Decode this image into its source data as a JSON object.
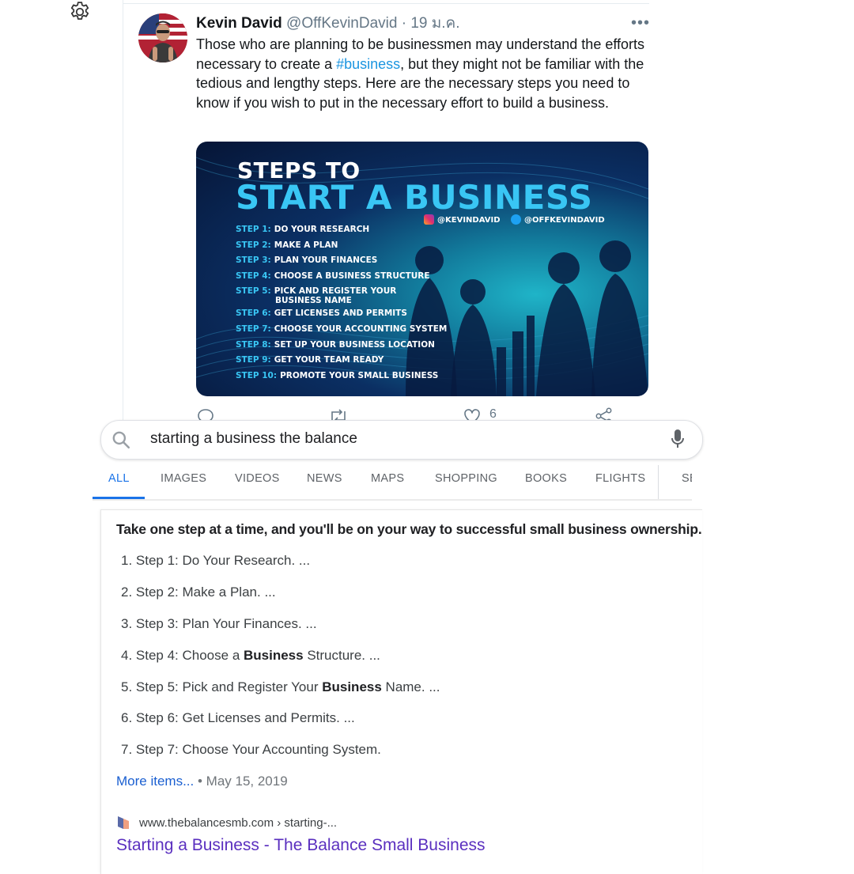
{
  "tweet": {
    "author_name": "Kevin David",
    "author_handle": "@OffKevinDavid",
    "separator": "·",
    "date": "19 ม.ค.",
    "more_label": "•••",
    "text_before": "Those who are planning to be businessmen may understand the efforts necessary to create a ",
    "hashtag": "#business",
    "text_after": ", but they might not be familiar with the tedious and lengthy steps. Here are the necessary steps you need to know if you wish to put in the necessary effort to build a business.",
    "like_count": "6",
    "card": {
      "title_line1": "STEPS TO",
      "title_line2": "START A BUSINESS",
      "instagram": "@KEVINDAVID",
      "twitter": "@OFFKEVINDAVID",
      "steps": [
        {
          "num": "STEP 1:",
          "text": "DO YOUR RESEARCH"
        },
        {
          "num": "STEP 2:",
          "text": "MAKE A PLAN"
        },
        {
          "num": "STEP 3:",
          "text": "PLAN YOUR FINANCES"
        },
        {
          "num": "STEP 4:",
          "text": "CHOOSE A BUSINESS STRUCTURE"
        },
        {
          "num": "STEP 5:",
          "text": "PICK AND REGISTER YOUR",
          "text2": "BUSINESS NAME"
        },
        {
          "num": "STEP 6:",
          "text": "GET LICENSES AND PERMITS"
        },
        {
          "num": "STEP 7:",
          "text": "CHOOSE YOUR ACCOUNTING SYSTEM"
        },
        {
          "num": "STEP 8:",
          "text": "SET UP YOUR BUSINESS LOCATION"
        },
        {
          "num": "STEP 9:",
          "text": "GET YOUR TEAM READY"
        },
        {
          "num": "STEP 10:",
          "text": "PROMOTE YOUR SMALL BUSINESS"
        }
      ]
    }
  },
  "search": {
    "query": "starting a business the balance",
    "tabs": [
      "ALL",
      "IMAGES",
      "VIDEOS",
      "NEWS",
      "MAPS",
      "SHOPPING",
      "BOOKS",
      "FLIGHTS",
      "SE"
    ],
    "active_tab": "ALL"
  },
  "snippet": {
    "heading": "Take one step at a time, and you'll be on your way to successful small business ownership.",
    "items": [
      {
        "before": "1. Step 1: Do Your Research. ...",
        "bold": "",
        "after": ""
      },
      {
        "before": "2. Step 2: Make a Plan. ...",
        "bold": "",
        "after": ""
      },
      {
        "before": "3. Step 3: Plan Your Finances. ...",
        "bold": "",
        "after": ""
      },
      {
        "before": "4. Step 4: Choose a ",
        "bold": "Business",
        "after": " Structure. ..."
      },
      {
        "before": "5. Step 5: Pick and Register Your ",
        "bold": "Business",
        "after": " Name. ..."
      },
      {
        "before": "6. Step 6: Get Licenses and Permits. ...",
        "bold": "",
        "after": ""
      },
      {
        "before": "7. Step 7: Choose Your Accounting System.",
        "bold": "",
        "after": ""
      }
    ],
    "more_label": "More items...",
    "date_sep": " • ",
    "date": "May 15, 2019",
    "result_url": "www.thebalancesmb.com › starting-...",
    "result_title": "Starting a Business - The Balance Small Business"
  },
  "colors": {
    "link_blue": "#1a73e8",
    "hashtag_blue": "#1b95e0",
    "visited_purple": "#5a2fbf",
    "card_accent": "#39c6f4"
  },
  "icons": [
    "gear-icon",
    "reply-icon",
    "retweet-icon",
    "like-icon",
    "share-icon",
    "search-icon",
    "mic-icon",
    "favicon-icon"
  ]
}
